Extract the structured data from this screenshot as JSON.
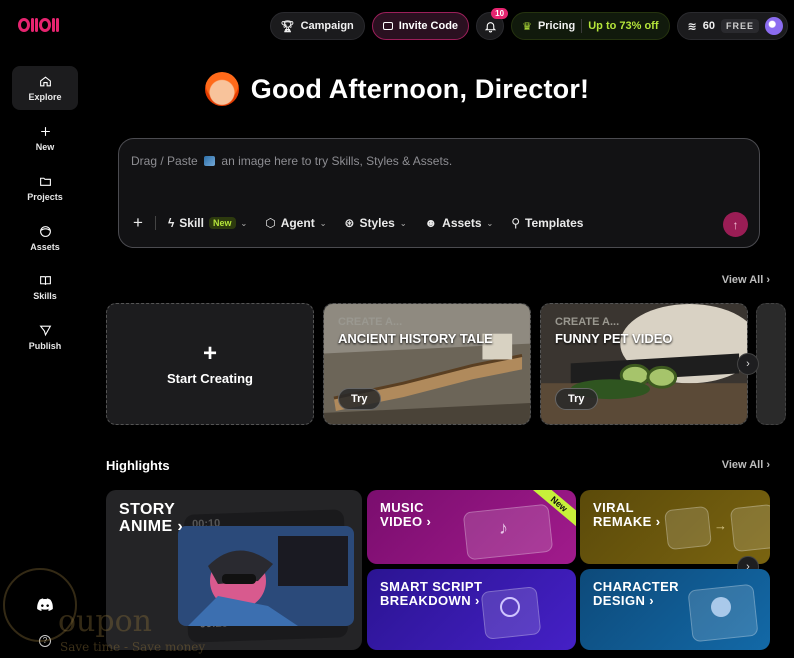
{
  "brand": {
    "logo_text": "OiiOii"
  },
  "topbar": {
    "campaign_label": "Campaign",
    "invite_label": "Invite Code",
    "notifications_count": "10",
    "pricing_label": "Pricing",
    "pricing_discount": "Up to 73% off",
    "credits_value": "60",
    "plan_label": "FREE"
  },
  "sidebar": {
    "items": [
      {
        "label": "Explore",
        "icon": "home-icon",
        "active": true
      },
      {
        "label": "New",
        "icon": "plus-icon"
      },
      {
        "label": "Projects",
        "icon": "folder-icon"
      },
      {
        "label": "Assets",
        "icon": "face-icon"
      },
      {
        "label": "Skills",
        "icon": "book-icon"
      },
      {
        "label": "Publish",
        "icon": "send-icon"
      }
    ]
  },
  "greeting": {
    "text": "Good Afternoon, Director!"
  },
  "prompt": {
    "placeholder_before": "Drag / Paste",
    "placeholder_after": "an image here to try Skills, Styles & Assets.",
    "tools": {
      "skill": "Skill",
      "skill_tag": "New",
      "agent": "Agent",
      "styles": "Styles",
      "assets": "Assets",
      "templates": "Templates"
    }
  },
  "create_section": {
    "view_all": "View All",
    "start_label": "Start Creating",
    "cards": [
      {
        "prefix": "CREATE A...",
        "name": "ANCIENT HISTORY TALE",
        "button": "Try"
      },
      {
        "prefix": "CREATE A...",
        "name": "FUNNY PET VIDEO",
        "button": "Try"
      }
    ]
  },
  "highlights": {
    "title": "Highlights",
    "view_all": "View All",
    "items": [
      {
        "line1": "STORY",
        "line2": "ANIME",
        "time1": "00:10",
        "time2": "00:25"
      },
      {
        "line1": "MUSIC",
        "line2": "VIDEO",
        "tag": "New"
      },
      {
        "line1": "VIRAL",
        "line2": "REMAKE"
      },
      {
        "line1": "SMART SCRIPT",
        "line2": "BREAKDOWN"
      },
      {
        "line1": "CHARACTER",
        "line2": "DESIGN"
      }
    ]
  },
  "watermark": {
    "text": "oupon",
    "sub": "Save time - Save money"
  },
  "colors": {
    "accent": "#e5246f",
    "lime": "#b5e53a",
    "background": "#000000"
  }
}
